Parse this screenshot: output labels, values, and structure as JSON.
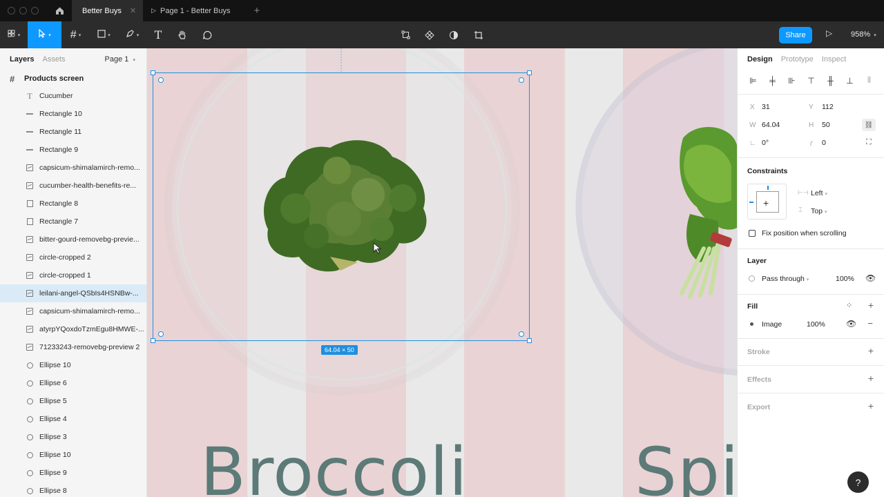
{
  "titlebar": {
    "tabs": [
      {
        "label": "Better Buys"
      },
      {
        "label": "Page 1 - Better Buys"
      }
    ]
  },
  "toolbar": {
    "share_label": "Share",
    "zoom": "958%"
  },
  "left_panel": {
    "tabs": {
      "layers": "Layers",
      "assets": "Assets"
    },
    "page_selector": "Page 1",
    "frame_name": "Products screen",
    "layers": [
      {
        "label": "Cucumber",
        "icon": "text"
      },
      {
        "label": "Rectangle 10",
        "icon": "line"
      },
      {
        "label": "Rectangle 11",
        "icon": "line"
      },
      {
        "label": "Rectangle 9",
        "icon": "line"
      },
      {
        "label": "capsicum-shimalamirch-remo...",
        "icon": "image"
      },
      {
        "label": "cucumber-health-benefits-re...",
        "icon": "image"
      },
      {
        "label": "Rectangle 8",
        "icon": "rect"
      },
      {
        "label": "Rectangle 7",
        "icon": "rect"
      },
      {
        "label": "bitter-gourd-removebg-previe...",
        "icon": "image"
      },
      {
        "label": "circle-cropped 2",
        "icon": "image"
      },
      {
        "label": "circle-cropped 1",
        "icon": "image"
      },
      {
        "label": "leilani-angel-QSbIs4HSNBw-...",
        "icon": "image",
        "selected": true
      },
      {
        "label": "capsicum-shimalamirch-remo...",
        "icon": "image"
      },
      {
        "label": "atyrpYQoxdoTzmEgu8HMWE-...",
        "icon": "image"
      },
      {
        "label": "71233243-removebg-preview 2",
        "icon": "image"
      },
      {
        "label": "Ellipse 10",
        "icon": "ellipse"
      },
      {
        "label": "Ellipse 6",
        "icon": "ellipse"
      },
      {
        "label": "Ellipse 5",
        "icon": "ellipse"
      },
      {
        "label": "Ellipse 4",
        "icon": "ellipse"
      },
      {
        "label": "Ellipse 3",
        "icon": "ellipse"
      },
      {
        "label": "Ellipse 10",
        "icon": "ellipse"
      },
      {
        "label": "Ellipse 9",
        "icon": "ellipse"
      },
      {
        "label": "Ellipse 8",
        "icon": "ellipse"
      }
    ]
  },
  "canvas": {
    "broccoli_text": "Broccoli",
    "spinach_text": "Spi",
    "size_badge": "64.04 × 50",
    "colors": {
      "stripe": "#ead3d5",
      "text": "#5c7a77",
      "selection": "#1e8fe0"
    }
  },
  "right_panel": {
    "tabs": {
      "design": "Design",
      "prototype": "Prototype",
      "inspect": "Inspect"
    },
    "x_label": "X",
    "x": "31",
    "y_label": "Y",
    "y": "112",
    "w_label": "W",
    "w": "64.04",
    "h_label": "H",
    "h": "50",
    "rotation": "0°",
    "radius": "0",
    "constraints_title": "Constraints",
    "constraint_h": "Left",
    "constraint_v": "Top",
    "fix_position_label": "Fix position when scrolling",
    "layer_title": "Layer",
    "blend_mode": "Pass through",
    "layer_opacity": "100%",
    "fill_title": "Fill",
    "fill_type": "Image",
    "fill_opacity": "100%",
    "stroke_title": "Stroke",
    "effects_title": "Effects",
    "export_title": "Export"
  },
  "help_label": "?"
}
